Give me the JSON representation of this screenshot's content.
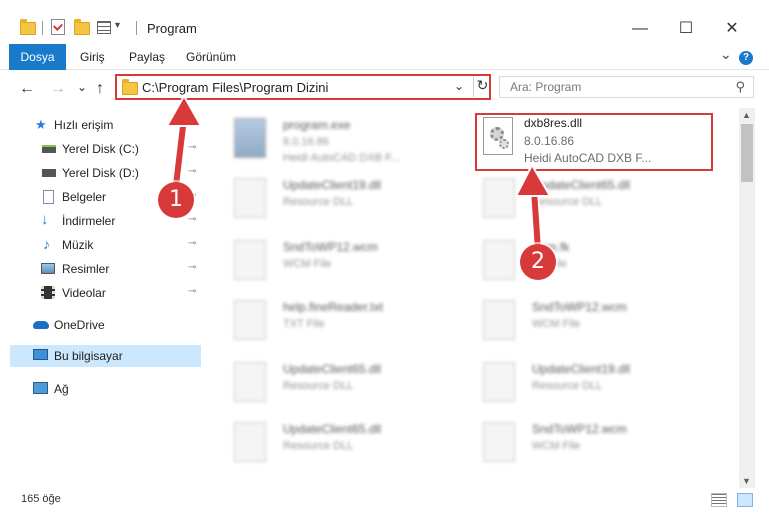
{
  "window": {
    "title": "Program",
    "controls": {
      "minimize": "—",
      "maximize": "☐",
      "close": "✕"
    }
  },
  "ribbon": {
    "file_tab": "Dosya",
    "tabs": [
      "Giriş",
      "Paylaş",
      "Görünüm"
    ],
    "help": "?",
    "collapse": "⌄"
  },
  "nav": {
    "back": "←",
    "forward": "→",
    "recent": "⌄",
    "up": "↑",
    "address": "C:\\Program Files\\Program Dizini",
    "dropdown": "⌄",
    "refresh": "↻",
    "search_placeholder": "Ara: Program",
    "search_icon": "⚲"
  },
  "sidebar": {
    "items": [
      {
        "label": "Hızlı erişim",
        "icon": "star-icon",
        "pinned": false
      },
      {
        "label": "Yerel Disk (C:)",
        "icon": "drive-icon",
        "pinned": true
      },
      {
        "label": "Yerel Disk (D:)",
        "icon": "drive-icon",
        "pinned": true
      },
      {
        "label": "Belgeler",
        "icon": "documents-icon",
        "pinned": true
      },
      {
        "label": "İndirmeler",
        "icon": "download-icon",
        "pinned": true
      },
      {
        "label": "Müzik",
        "icon": "music-icon",
        "pinned": true
      },
      {
        "label": "Resimler",
        "icon": "pictures-icon",
        "pinned": true
      },
      {
        "label": "Videolar",
        "icon": "video-icon",
        "pinned": true
      },
      {
        "label": "OneDrive",
        "icon": "cloud-icon",
        "pinned": false
      },
      {
        "label": "Bu bilgisayar",
        "icon": "computer-icon",
        "pinned": false,
        "selected": true
      },
      {
        "label": "Ağ",
        "icon": "network-icon",
        "pinned": false
      }
    ],
    "pin_glyph": "📌"
  },
  "files": [
    {
      "name": "program.exe",
      "line1": "8.0.16.86",
      "line2": "Heidi AutoCAD DXB F...",
      "icon": "exe-icon",
      "blurred": true
    },
    {
      "name": "dxb8res.dll",
      "line1": "8.0.16.86",
      "line2": "Heidi AutoCAD DXB F...",
      "icon": "dll-gear-icon",
      "blurred": false
    },
    {
      "name": "UpdateClient19.dll",
      "line1": "Resource DLL",
      "line2": "",
      "icon": "file-icon",
      "blurred": true
    },
    {
      "name": "UpdateClient65.dll",
      "line1": "Resource DLL",
      "line2": "",
      "icon": "file-icon",
      "blurred": true
    },
    {
      "name": "SndToWP12.wcm",
      "line1": "WCM File",
      "line2": "",
      "icon": "file-icon",
      "blurred": true
    },
    {
      "name": "wcm.fk",
      "line1": "FK File",
      "line2": "",
      "icon": "file-icon",
      "blurred": true
    },
    {
      "name": "help.fineReader.txt",
      "line1": "TXT File",
      "line2": "",
      "icon": "file-icon",
      "blurred": true
    },
    {
      "name": "SndToWP12.wcm",
      "line1": "WCM File",
      "line2": "",
      "icon": "file-icon",
      "blurred": true
    },
    {
      "name": "UpdateClient65.dll",
      "line1": "Resource DLL",
      "line2": "",
      "icon": "file-icon",
      "blurred": true
    },
    {
      "name": "UpdateClient19.dll",
      "line1": "Resource DLL",
      "line2": "",
      "icon": "file-icon",
      "blurred": true
    },
    {
      "name": "UpdateClient65.dll",
      "line1": "Resource DLL",
      "line2": "",
      "icon": "file-icon",
      "blurred": true
    },
    {
      "name": "SndToWP12.wcm",
      "line1": "WCM File",
      "line2": "",
      "icon": "file-icon",
      "blurred": true
    }
  ],
  "status": {
    "count": "165 öğe"
  },
  "callouts": [
    "1",
    "2"
  ],
  "colors": {
    "accent": "#1979ca",
    "highlight": "#d83a3a",
    "selected_bg": "#cce8ff"
  }
}
